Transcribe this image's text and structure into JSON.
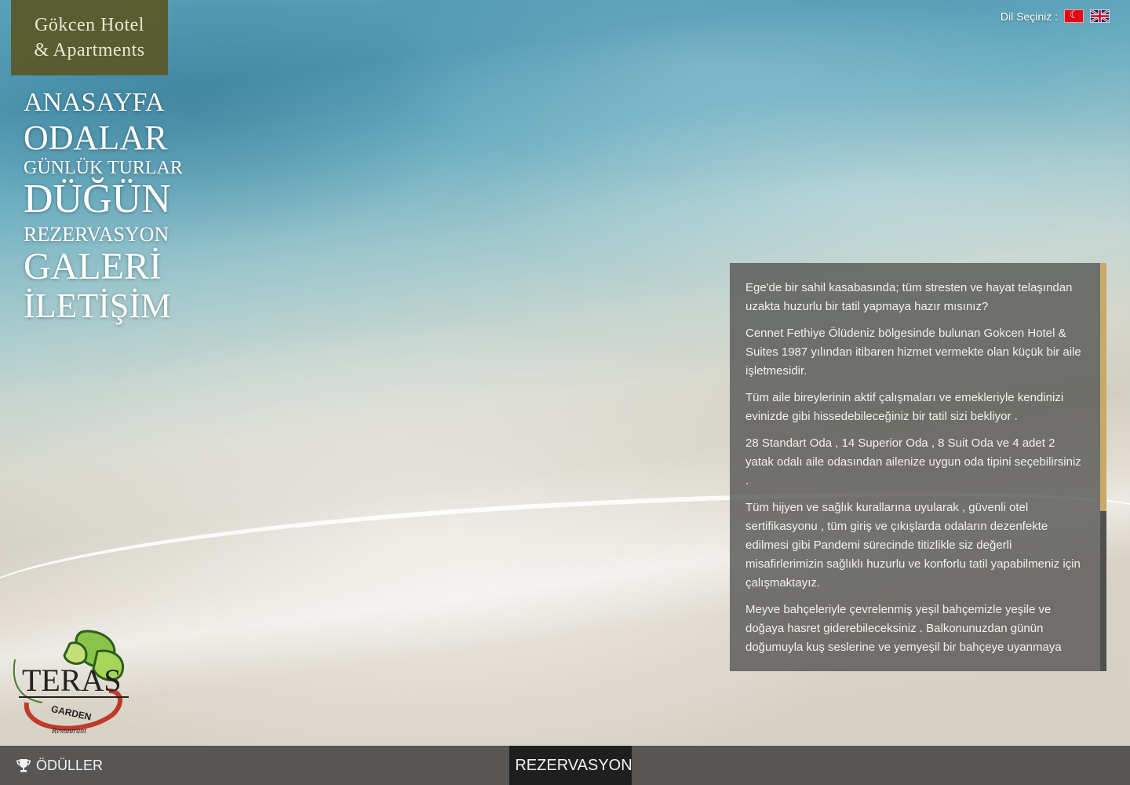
{
  "brand": {
    "line1": "Gökcen Hotel",
    "line2": "& Apartments"
  },
  "nav": {
    "items": [
      {
        "label": "ANASAYFA"
      },
      {
        "label": "ODALAR"
      },
      {
        "label": "GÜNLÜK TURLAR"
      },
      {
        "label": "DÜĞÜN"
      },
      {
        "label": "REZERVASYON"
      },
      {
        "label": "GALERİ"
      },
      {
        "label": "İLETİŞİM"
      }
    ]
  },
  "language": {
    "label": "Dil Seçiniz :",
    "options": [
      "Türkçe",
      "English"
    ]
  },
  "content": {
    "paragraphs": [
      "Ege'de bir sahil kasabasında; tüm stresten ve hayat telaşından uzakta huzurlu bir tatil yapmaya hazır mısınız?",
      "Cennet Fethiye Ölüdeniz bölgesinde bulunan Gokcen Hotel & Suites 1987 yılından itibaren hizmet vermekte olan küçük bir aile işletmesidir.",
      "Tüm aile bireylerinin aktif çalışmaları ve emekleriyle kendinizi evinizde gibi hissedebileceğiniz bir tatil sizi bekliyor .",
      "28 Standart Oda , 14 Superior Oda , 8 Suit Oda ve 4 adet  2 yatak odalı aile odasından ailenize uygun oda tipini seçebilirsiniz .",
      "Tüm hijyen ve sağlık kurallarına uyularak , güvenli otel sertifikasyonu , tüm giriş ve çıkışlarda odaların dezenfekte edilmesi gibi Pandemi sürecinde titizlikle siz değerli misafirlerimizin sağlıklı huzurlu ve konforlu tatil yapabilmeniz için çalışmaktayız.",
      "Meyve bahçeleriyle çevrelenmiş yeşil bahçemizle yeşile ve doğaya hasret giderebileceksiniz . Balkonunuzdan günün doğumuyla kuş seslerine ve yemyeşil bir bahçeye uyanmaya"
    ]
  },
  "logo": {
    "name": "TERAS",
    "sub": "GARDEN",
    "tag": "Restaurant"
  },
  "footer": {
    "awards_label": "ÖDÜLLER",
    "reservation_label": "REZERVASYON"
  },
  "colors": {
    "brand_box": "#5a5a2a",
    "panel": "#585856",
    "scroll_thumb": "#c9a966",
    "footer": "#575654",
    "reservation_bg": "#1f1f1f"
  }
}
